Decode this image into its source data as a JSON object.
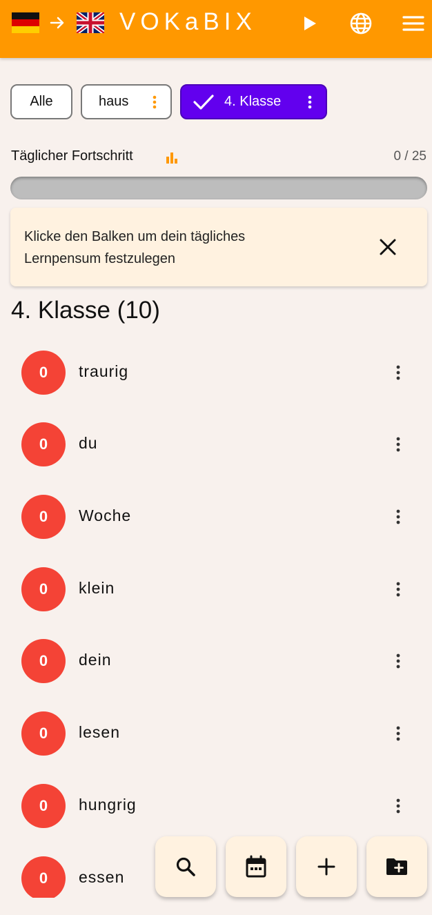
{
  "header": {
    "source_flag": "german-flag-icon",
    "target_flag": "uk-flag-icon",
    "arrow": "→",
    "logo": "VOKaBIX",
    "icons": [
      "play-icon",
      "globe-icon",
      "menu-icon"
    ],
    "color": "#ff9800"
  },
  "chips": {
    "all": "Alle",
    "haus": "haus",
    "klasse": "4. Klasse",
    "selected_color": "#6200ee"
  },
  "progress": {
    "label": "Täglicher Fortschritt",
    "count": "0 / 25",
    "fraction": 0
  },
  "tip": {
    "text": "Klicke den Balken um dein tägliches Lernpensum festzulegen"
  },
  "list": {
    "title": "4. Klasse (10)",
    "items": [
      {
        "count": "0",
        "word": "traurig"
      },
      {
        "count": "0",
        "word": "du"
      },
      {
        "count": "0",
        "word": "Woche"
      },
      {
        "count": "0",
        "word": "klein"
      },
      {
        "count": "0",
        "word": "dein"
      },
      {
        "count": "0",
        "word": "lesen"
      },
      {
        "count": "0",
        "word": "hungrig"
      },
      {
        "count": "0",
        "word": "essen"
      }
    ],
    "badge_color": "#f44336"
  },
  "fabs": [
    "search-icon",
    "calendar-icon",
    "add-icon",
    "add-folder-icon"
  ]
}
